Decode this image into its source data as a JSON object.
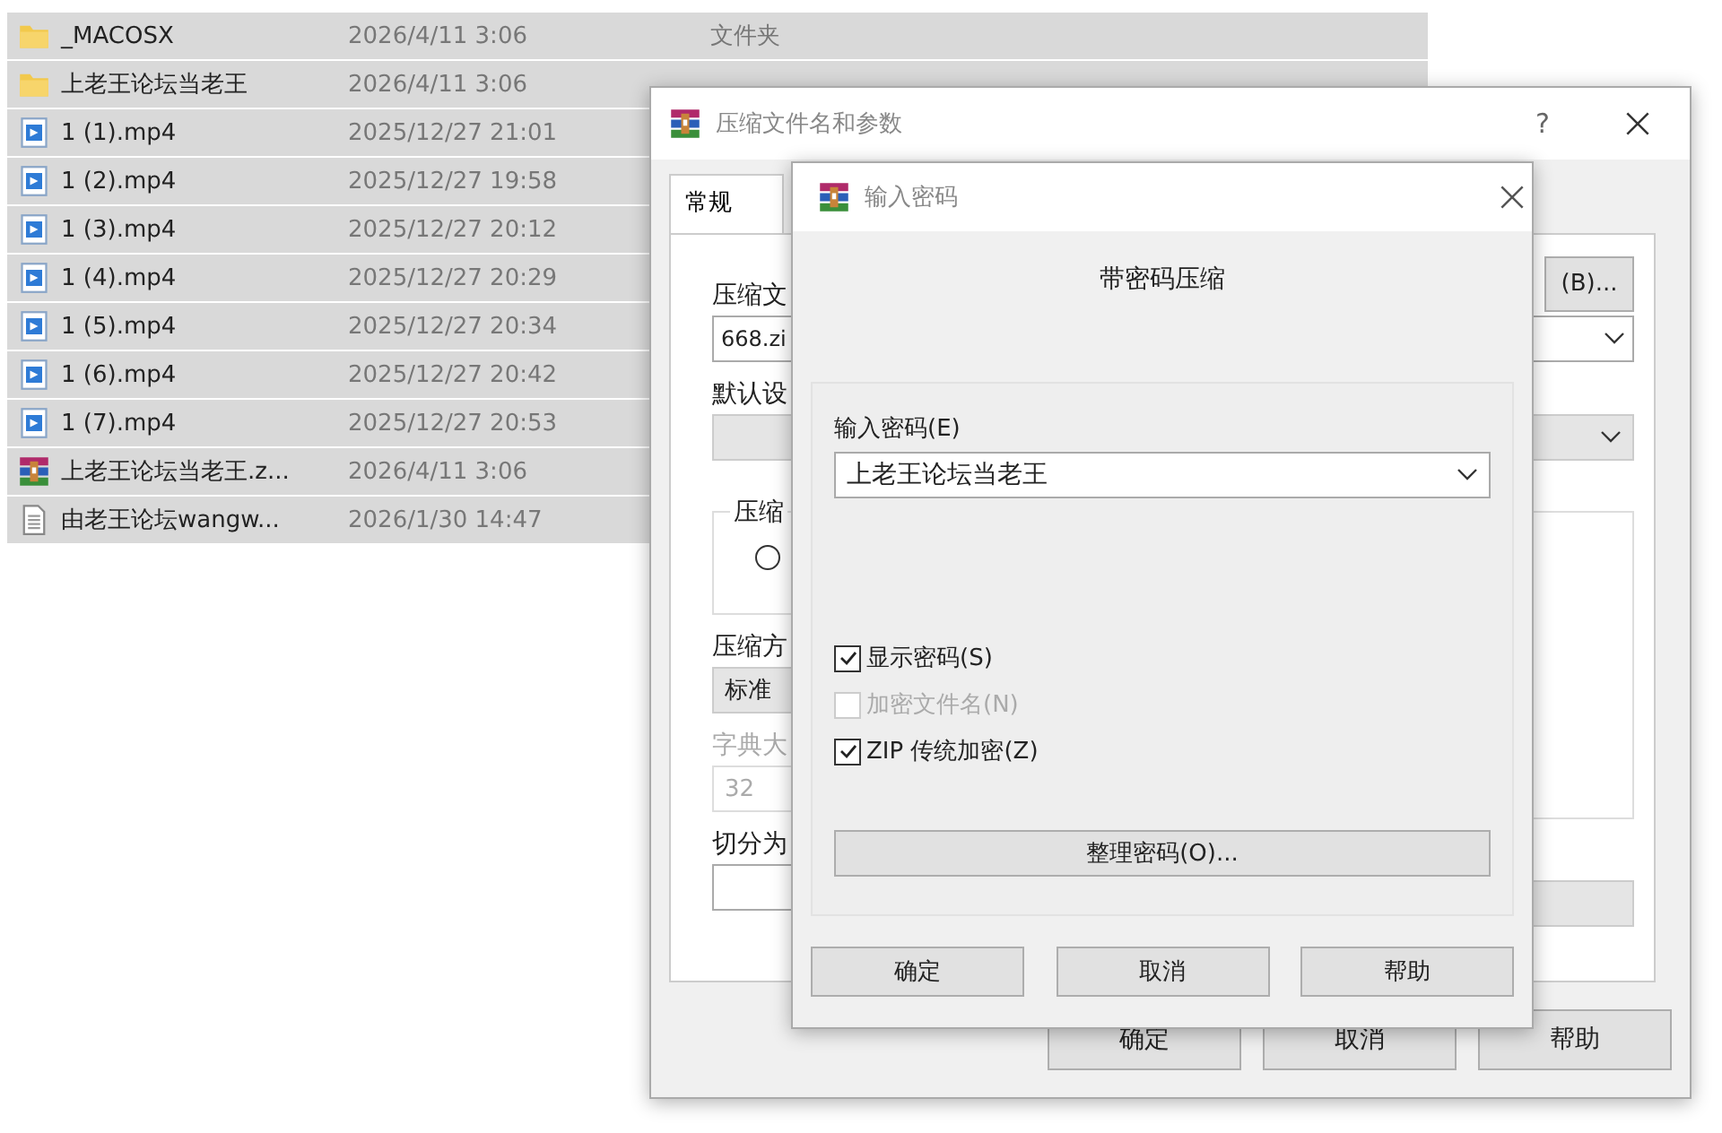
{
  "file_list": {
    "rows": [
      {
        "kind": "folder",
        "name": "_MACOSX",
        "date": "2026/4/11 3:06",
        "type": "文件夹",
        "selected": true
      },
      {
        "kind": "folder",
        "name": "上老王论坛当老王",
        "date": "2026/4/11 3:06",
        "selected": true
      },
      {
        "kind": "video",
        "name": "1 (1).mp4",
        "date": "2025/12/27 21:01",
        "selected": true
      },
      {
        "kind": "video",
        "name": "1 (2).mp4",
        "date": "2025/12/27 19:58",
        "selected": true
      },
      {
        "kind": "video",
        "name": "1 (3).mp4",
        "date": "2025/12/27 20:12",
        "selected": true
      },
      {
        "kind": "video",
        "name": "1 (4).mp4",
        "date": "2025/12/27 20:29",
        "selected": true
      },
      {
        "kind": "video",
        "name": "1 (5).mp4",
        "date": "2025/12/27 20:34",
        "selected": true
      },
      {
        "kind": "video",
        "name": "1 (6).mp4",
        "date": "2025/12/27 20:42",
        "selected": true
      },
      {
        "kind": "video",
        "name": "1 (7).mp4",
        "date": "2025/12/27 20:53",
        "selected": true
      },
      {
        "kind": "archive",
        "name": "上老王论坛当老王.z...",
        "date": "2026/4/11 3:06",
        "selected": true
      },
      {
        "kind": "text",
        "name": "由老王论坛wangw...",
        "date": "2026/1/30 14:47",
        "selected": true
      }
    ]
  },
  "archive_dialog": {
    "title": "压缩文件名和参数",
    "help": "?",
    "tabs": [
      {
        "label": "常规",
        "selected": true
      }
    ],
    "archive_label": "压缩文",
    "browse_button": "(B)...",
    "archive_name": "668.zi",
    "profile_label": "默认设",
    "format_group": "压缩",
    "format_radio_selected": false,
    "method_label": "压缩方",
    "method_value": "标准",
    "dictionary_label": "字典大",
    "dictionary_value": "32",
    "split_label": "切分为",
    "buttons": [
      "确定",
      "取消",
      "帮助"
    ]
  },
  "password_dialog": {
    "title": "输入密码",
    "heading": "带密码压缩",
    "password_label": "输入密码(E)",
    "password_value": "上老王论坛当老王",
    "options": [
      {
        "label": "显示密码(S)",
        "checked": true,
        "disabled": false
      },
      {
        "label": "加密文件名(N)",
        "checked": false,
        "disabled": true
      },
      {
        "label": "ZIP 传统加密(Z)",
        "checked": true,
        "disabled": false
      }
    ],
    "manage_button": "整理密码(O)...",
    "buttons": [
      "确定",
      "取消",
      "帮助"
    ]
  }
}
